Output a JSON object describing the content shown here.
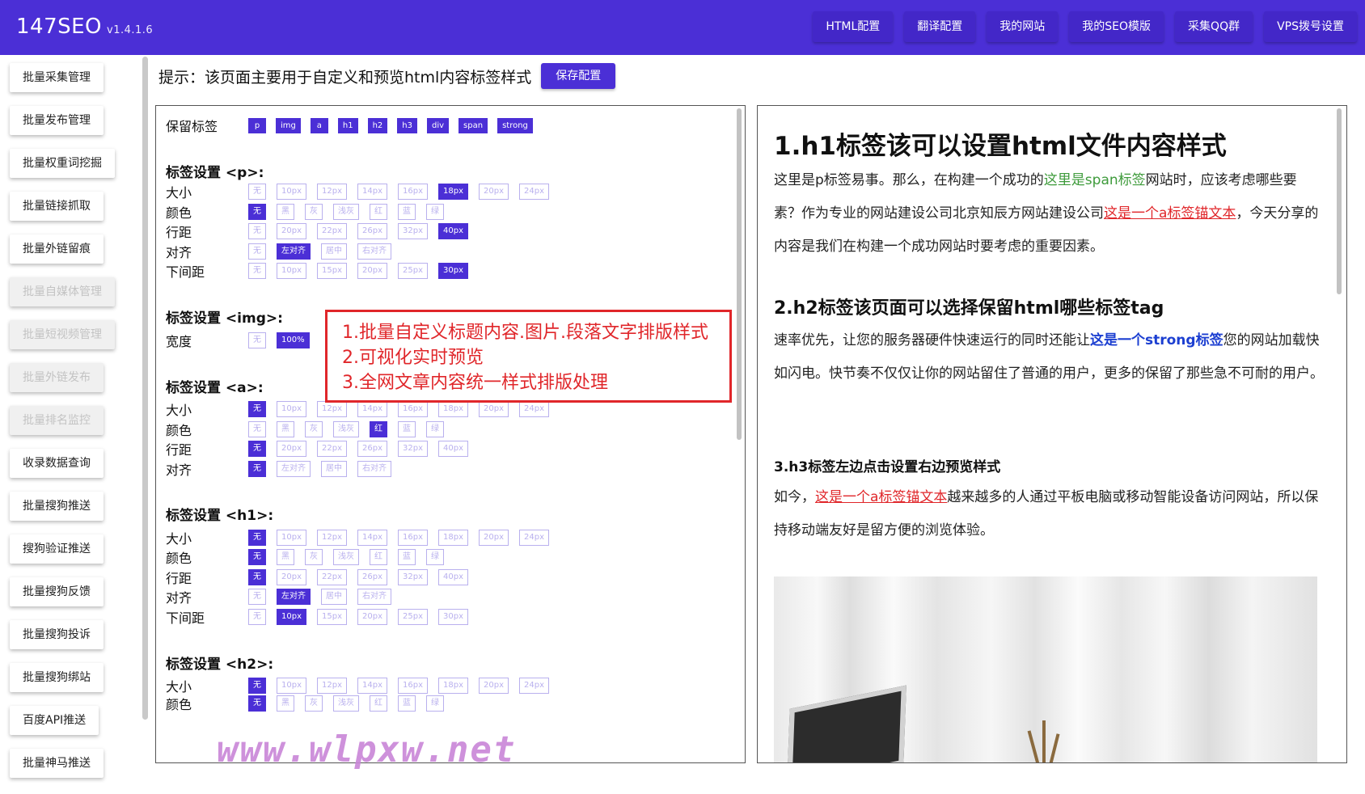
{
  "app": {
    "name": "147SEO",
    "version": "v1.4.1.6"
  },
  "topnav": [
    "HTML配置",
    "翻译配置",
    "我的网站",
    "我的SEO模版",
    "采集QQ群",
    "VPS拨号设置"
  ],
  "sidebar": [
    {
      "label": "批量采集管理",
      "disabled": false
    },
    {
      "label": "批量发布管理",
      "disabled": false
    },
    {
      "label": "批量权重词挖掘",
      "disabled": false
    },
    {
      "label": "批量链接抓取",
      "disabled": false
    },
    {
      "label": "批量外链留痕",
      "disabled": false
    },
    {
      "label": "批量自媒体管理",
      "disabled": true
    },
    {
      "label": "批量短视频管理",
      "disabled": true
    },
    {
      "label": "批量外链发布",
      "disabled": true
    },
    {
      "label": "批量排名监控",
      "disabled": true
    },
    {
      "label": "收录数据查询",
      "disabled": false
    },
    {
      "label": "批量搜狗推送",
      "disabled": false
    },
    {
      "label": "搜狗验证推送",
      "disabled": false
    },
    {
      "label": "批量搜狗反馈",
      "disabled": false
    },
    {
      "label": "批量搜狗投诉",
      "disabled": false
    },
    {
      "label": "批量搜狗绑站",
      "disabled": false
    },
    {
      "label": "百度API推送",
      "disabled": false
    },
    {
      "label": "批量神马推送",
      "disabled": false
    }
  ],
  "tip": "提示：该页面主要用于自定义和预览html内容标签样式",
  "save_label": "保存配置",
  "keep": {
    "label": "保留标签",
    "tags": [
      "p",
      "img",
      "a",
      "h1",
      "h2",
      "h3",
      "div",
      "span",
      "strong"
    ]
  },
  "sections": {
    "p": {
      "title": "标签设置 <p>:",
      "rows": [
        {
          "label": "大小",
          "options": [
            "无",
            "10px",
            "12px",
            "14px",
            "16px",
            "18px",
            "20px",
            "24px"
          ],
          "selected": 5
        },
        {
          "label": "颜色",
          "options": [
            "无",
            "黑",
            "灰",
            "浅灰",
            "红",
            "蓝",
            "绿"
          ],
          "selected": 0
        },
        {
          "label": "行距",
          "options": [
            "无",
            "20px",
            "22px",
            "26px",
            "32px",
            "40px"
          ],
          "selected": 5
        },
        {
          "label": "对齐",
          "options": [
            "无",
            "左对齐",
            "居中",
            "右对齐"
          ],
          "selected": 1
        },
        {
          "label": "下间距",
          "options": [
            "无",
            "10px",
            "15px",
            "20px",
            "25px",
            "30px"
          ],
          "selected": 5
        }
      ]
    },
    "img": {
      "title": "标签设置 <img>:",
      "rows": [
        {
          "label": "宽度",
          "options": [
            "无",
            "100%"
          ],
          "selected": 1
        }
      ]
    },
    "a": {
      "title": "标签设置 <a>:",
      "rows": [
        {
          "label": "大小",
          "options": [
            "无",
            "10px",
            "12px",
            "14px",
            "16px",
            "18px",
            "20px",
            "24px"
          ],
          "selected": 0
        },
        {
          "label": "颜色",
          "options": [
            "无",
            "黑",
            "灰",
            "浅灰",
            "红",
            "蓝",
            "绿"
          ],
          "selected": 4
        },
        {
          "label": "行距",
          "options": [
            "无",
            "20px",
            "22px",
            "26px",
            "32px",
            "40px"
          ],
          "selected": 0
        },
        {
          "label": "对齐",
          "options": [
            "无",
            "左对齐",
            "居中",
            "右对齐"
          ],
          "selected": 0
        }
      ]
    },
    "h1": {
      "title": "标签设置 <h1>:",
      "rows": [
        {
          "label": "大小",
          "options": [
            "无",
            "10px",
            "12px",
            "14px",
            "16px",
            "18px",
            "20px",
            "24px"
          ],
          "selected": 0
        },
        {
          "label": "颜色",
          "options": [
            "无",
            "黑",
            "灰",
            "浅灰",
            "红",
            "蓝",
            "绿"
          ],
          "selected": 0
        },
        {
          "label": "行距",
          "options": [
            "无",
            "20px",
            "22px",
            "26px",
            "32px",
            "40px"
          ],
          "selected": 0
        },
        {
          "label": "对齐",
          "options": [
            "无",
            "左对齐",
            "居中",
            "右对齐"
          ],
          "selected": 1
        },
        {
          "label": "下间距",
          "options": [
            "无",
            "10px",
            "15px",
            "20px",
            "25px",
            "30px"
          ],
          "selected": 1
        }
      ]
    },
    "h2": {
      "title": "标签设置 <h2>:",
      "rows": [
        {
          "label": "大小",
          "options": [
            "无",
            "10px",
            "12px",
            "14px",
            "16px",
            "18px",
            "20px",
            "24px"
          ],
          "selected": 0
        },
        {
          "label": "颜色",
          "options": [
            "无",
            "黑",
            "灰",
            "浅灰",
            "红",
            "蓝",
            "绿"
          ],
          "selected": 0
        }
      ]
    }
  },
  "callout": [
    "1.批量自定义标题内容.图片.段落文字排版样式",
    "2.可视化实时预览",
    "3.全网文章内容统一样式排版处理"
  ],
  "watermark": "www.wlpxw.net",
  "preview": {
    "h1": "1.h1标签该可以设置html文件内容样式",
    "p1_a": "这里是p标签易事。那么，在构建一个成功的",
    "p1_span": "这里是span标签",
    "p1_b": "网站时，应该考虑哪些要素？作为专业的网站建设公司北京知辰方网站建设公司",
    "p1_link": "这是一个a标签锚文本",
    "p1_c": "，今天分享的内容是我们在构建一个成功网站时要考虑的重要因素。",
    "h2": "2.h2标签该页面可以选择保留html哪些标签tag",
    "p2_a": "速率优先，让您的服务器硬件快速运行的同时还能让",
    "p2_strong": "这是一个strong标签",
    "p2_b": "您的网站加载快如闪电。快节奏不仅仅让你的网站留住了普通的用户，更多的保留了那些急不可耐的用户。",
    "h3": "3.h3标签左边点击设置右边预览样式",
    "p3_a": "如今，",
    "p3_link": "这是一个a标签锚文本",
    "p3_b": "越来越多的人通过平板电脑或移动智能设备访问网站，所以保持移动端友好是留方便的浏览体验。"
  },
  "colors": {
    "accent": "#4b2fd6",
    "callout": "#e0262a",
    "span": "#3e9b3b",
    "strong": "#1c3fd1"
  }
}
